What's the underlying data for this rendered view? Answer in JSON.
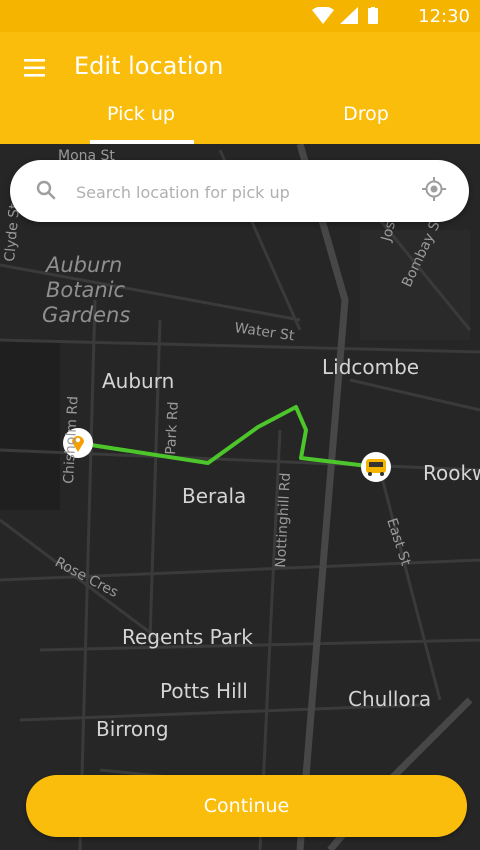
{
  "status_bar": {
    "time": "12:30",
    "icons": [
      "wifi-icon",
      "cellular-signal-icon",
      "battery-icon"
    ]
  },
  "app_bar": {
    "title": "Edit location",
    "menu_icon": "hamburger-menu-icon"
  },
  "tabs": [
    {
      "label": "Pick up",
      "selected": true
    },
    {
      "label": "Drop",
      "selected": false
    }
  ],
  "search": {
    "placeholder": "Search location for pick up",
    "icon": "search-icon",
    "action_icon": "my-location-icon"
  },
  "map": {
    "places": [
      "Auburn Botanic Gardens",
      "Auburn",
      "Lidcombe",
      "Berala",
      "Rookw",
      "Regents Park",
      "Potts Hill",
      "Chullora",
      "Birrong"
    ],
    "streets": [
      "Mona St",
      "Clyde St",
      "Water St",
      "Chisholm Rd",
      "Park Rd",
      "Nottinghill Rd",
      "East St",
      "Rose Cres",
      "Joseph St",
      "Bombay St"
    ],
    "route_color": "#4cc62a",
    "pickup_marker": "location-pin-icon",
    "drop_marker": "bus-icon"
  },
  "actions": {
    "continue_label": "Continue"
  },
  "colors": {
    "primary": "#fbbd0c",
    "status_bar": "#f5b400",
    "map_bg": "#262626"
  }
}
